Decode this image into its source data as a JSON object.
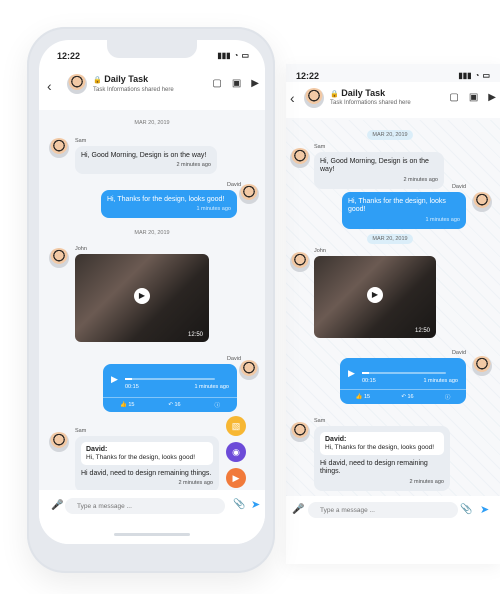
{
  "status": {
    "time": "12:22",
    "icons": [
      "signal-icon",
      "wifi-icon",
      "battery-icon"
    ]
  },
  "header": {
    "title": "Daily Task",
    "subtitle": "Task Informations shared here",
    "icons": [
      "chat-icon",
      "clipboard-icon",
      "video-call-icon"
    ],
    "back_icon": "back-icon"
  },
  "messages": [
    {
      "type": "date",
      "text": "MAR 20, 2019"
    },
    {
      "type": "text",
      "direction": "incoming",
      "sender": "Sam",
      "text": "Hi, Good Morning, Design is on the way!",
      "time": "2 minutes ago"
    },
    {
      "type": "text",
      "direction": "outgoing",
      "sender": "David",
      "text": "Hi, Thanks for the design, looks good!",
      "time": "1 minutes ago"
    },
    {
      "type": "date",
      "text": "MAR 20, 2019"
    },
    {
      "type": "video",
      "direction": "incoming",
      "sender": "John",
      "duration": "12:50"
    },
    {
      "type": "voice",
      "direction": "outgoing",
      "sender": "David",
      "elapsed": "00:15",
      "time": "1 minutes ago",
      "likes": "15",
      "replies": "16",
      "progress": 0.08
    },
    {
      "type": "reply",
      "direction": "incoming",
      "sender": "Sam",
      "quote_name": "David:",
      "quote_text": "Hi, Thanks for the design, looks good!",
      "text": "Hi david, need to design remaining things.",
      "time": "2 minutes ago"
    }
  ],
  "fabs": [
    {
      "name": "gallery-button",
      "icon": "image-icon",
      "color": "#f7b733"
    },
    {
      "name": "camera-button",
      "icon": "camera-icon",
      "color": "#6c4bd8"
    },
    {
      "name": "video-button",
      "icon": "video-icon",
      "color": "#f17a3b"
    }
  ],
  "composer": {
    "placeholder": "Type a message ..."
  },
  "colors": {
    "accent": "#2f9ef5",
    "incoming": "#e9edf2"
  }
}
